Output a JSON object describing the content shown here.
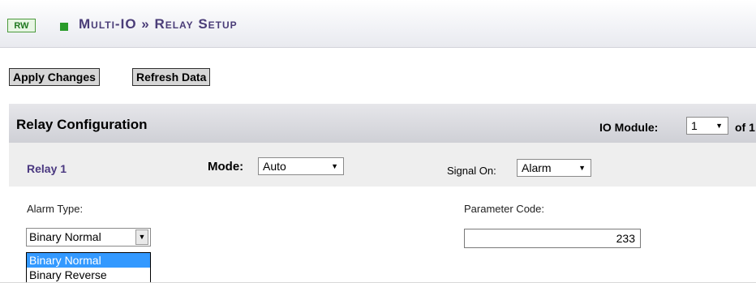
{
  "header": {
    "rw_badge": "RW",
    "title": "Multi-IO » Relay Setup"
  },
  "toolbar": {
    "apply_label": "Apply Changes",
    "refresh_label": "Refresh Data"
  },
  "panel": {
    "title": "Relay Configuration",
    "io_module_label": "IO Module:",
    "io_module_value": "1",
    "io_module_of": "of 1"
  },
  "relay": {
    "name": "Relay 1",
    "mode_label": "Mode:",
    "mode_value": "Auto",
    "signal_label": "Signal On:",
    "signal_value": "Alarm"
  },
  "alarm": {
    "label": "Alarm Type:",
    "value": "Binary Normal",
    "options": [
      "Binary Normal",
      "Binary Reverse"
    ]
  },
  "parameter": {
    "label": "Parameter Code:",
    "value": "233"
  },
  "colors": {
    "title": "#4a3d78",
    "badge": "#207820",
    "selection": "#3399ff"
  }
}
